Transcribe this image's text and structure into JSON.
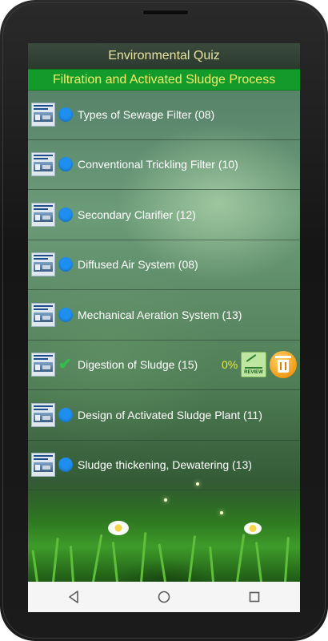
{
  "app": {
    "title": "Environmental Quiz",
    "subtitle": "Filtration and Activated Sludge Process"
  },
  "topics": [
    {
      "label": "Types of Sewage Filter (08)",
      "status": "not-started"
    },
    {
      "label": "Conventional Trickling Filter (10)",
      "status": "not-started"
    },
    {
      "label": "Secondary Clarifier (12)",
      "status": "not-started"
    },
    {
      "label": "Diffused Air System (08)",
      "status": "not-started"
    },
    {
      "label": "Mechanical Aeration System (13)",
      "status": "not-started"
    },
    {
      "label": "Digestion of Sludge (15)",
      "status": "completed",
      "score": "0%"
    },
    {
      "label": "Design of Activated Sludge Plant (11)",
      "status": "not-started"
    },
    {
      "label": "Sludge thickening, Dewatering (13)",
      "status": "not-started"
    }
  ],
  "review_badge": "REVIEW",
  "colors": {
    "title_text": "#e9e3a0",
    "subtitle_bg": "#129a2a",
    "subtitle_text": "#f4ec6a",
    "not_started_dot": "#1e8ff0",
    "completed_check": "#2ec04a",
    "score_text": "#e7ea3c"
  },
  "navigation": {
    "back": "back-icon",
    "home": "home-icon",
    "recents": "recents-icon"
  }
}
